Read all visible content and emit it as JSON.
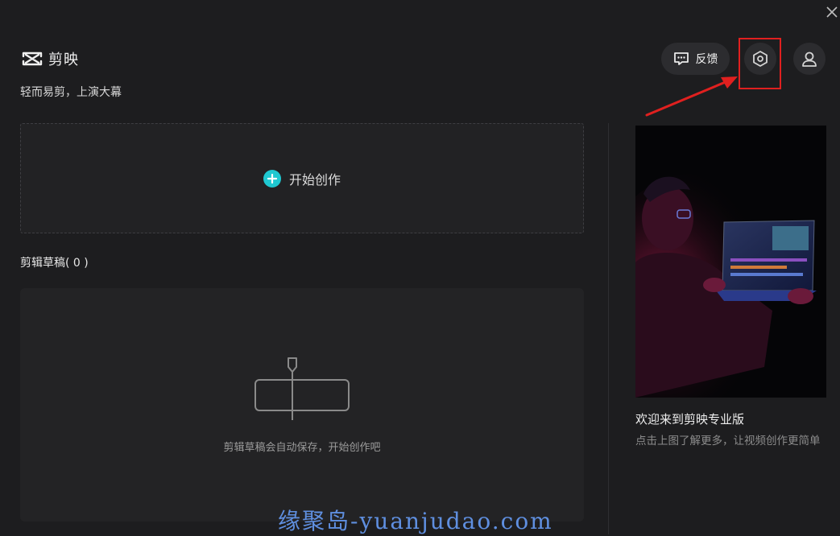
{
  "app": {
    "name": "剪映",
    "slogan": "轻而易剪，上演大幕"
  },
  "header": {
    "feedback_label": "反馈",
    "settings_icon": "settings-hexagon-icon",
    "profile_icon": "user-icon",
    "highlight_color": "#e0201f"
  },
  "start": {
    "label": "开始创作",
    "accent": "#1fc8d1"
  },
  "drafts": {
    "title": "剪辑草稿( 0 )",
    "empty_text": "剪辑草稿会自动保存，开始创作吧"
  },
  "promo": {
    "title": "欢迎来到剪映专业版",
    "description": "点击上图了解更多，让视频创作更简单"
  },
  "watermark": "缘聚岛-yuanjudao.com"
}
